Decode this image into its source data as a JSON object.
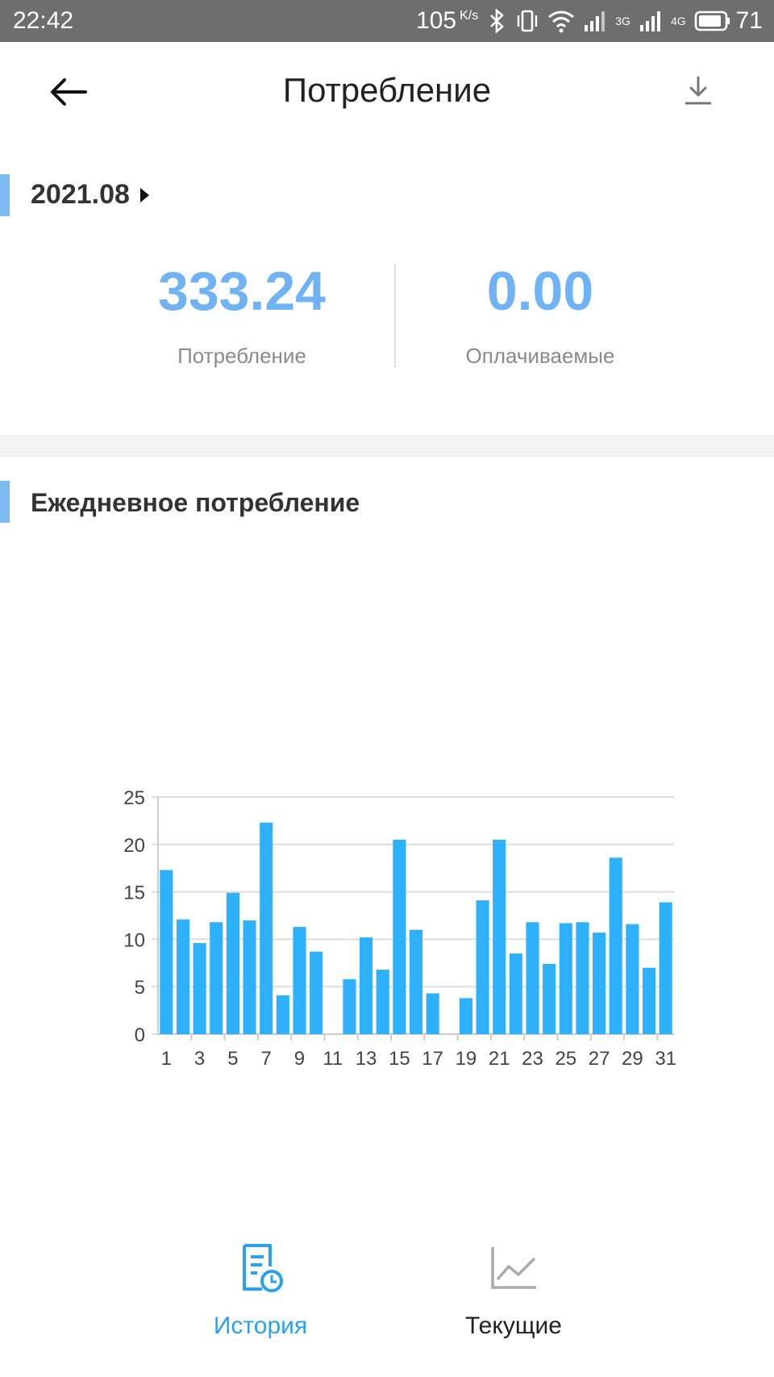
{
  "status_bar": {
    "time": "22:42",
    "speed": "105",
    "speed_unit": "K/s",
    "net_1": "3G",
    "net_2": "4G",
    "battery": "71"
  },
  "header": {
    "title": "Потребление",
    "back_icon": "arrow-left-icon",
    "download_icon": "download-icon"
  },
  "summary": {
    "month": "2021.08",
    "consumption_value": "333.24",
    "consumption_label": "Потребление",
    "billable_value": "0.00",
    "billable_label": "Оплачиваемые"
  },
  "daily_section": {
    "title": "Ежедневное потребление"
  },
  "colors": {
    "accent": "#7bbbf2",
    "value": "#6fb3f5",
    "bar": "#2fb0fa",
    "active_tab": "#2aa3ef"
  },
  "chart_data": {
    "type": "bar",
    "categories": [
      "1",
      "2",
      "3",
      "4",
      "5",
      "6",
      "7",
      "8",
      "9",
      "10",
      "11",
      "12",
      "13",
      "14",
      "15",
      "16",
      "17",
      "18",
      "19",
      "20",
      "21",
      "22",
      "23",
      "24",
      "25",
      "26",
      "27",
      "28",
      "29",
      "30",
      "31"
    ],
    "values": [
      17.3,
      12.1,
      9.6,
      11.8,
      14.9,
      12.0,
      22.3,
      4.1,
      11.3,
      8.7,
      0,
      5.8,
      10.2,
      6.8,
      20.5,
      11.0,
      4.3,
      0,
      3.8,
      14.1,
      20.5,
      8.5,
      11.8,
      7.4,
      11.7,
      11.8,
      10.7,
      18.6,
      11.6,
      7.0,
      13.9
    ],
    "tick_labels": [
      "1",
      "3",
      "5",
      "7",
      "9",
      "11",
      "13",
      "15",
      "17",
      "19",
      "21",
      "23",
      "25",
      "27",
      "29",
      "31"
    ],
    "yticks": [
      "0",
      "5",
      "10",
      "15",
      "20",
      "25"
    ],
    "ylim": [
      0,
      25
    ],
    "grid": true
  },
  "bottom_nav": {
    "tabs": [
      {
        "label": "История",
        "icon": "history-document-icon",
        "active": true
      },
      {
        "label": "Текущие",
        "icon": "line-chart-icon",
        "active": false
      }
    ]
  }
}
